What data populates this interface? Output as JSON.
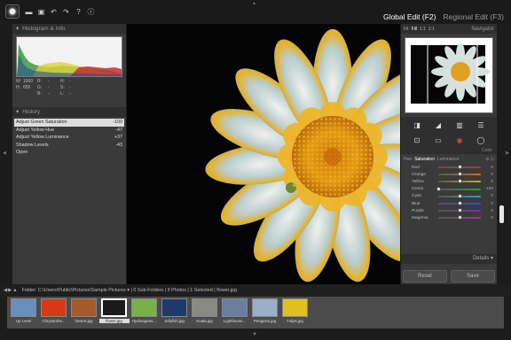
{
  "header": {
    "modes": [
      {
        "label": "Global Edit (F2)",
        "active": true
      },
      {
        "label": "Regional Edit (F3)",
        "active": false
      }
    ],
    "toolbar_icons": [
      "folder-icon",
      "save-icon",
      "undo-icon",
      "redo-icon",
      "help-icon",
      "info-icon"
    ],
    "toolbar_glyphs": [
      "▬",
      "▣",
      "↶",
      "↷",
      "?",
      "ⓘ"
    ]
  },
  "histogram": {
    "title": "Histogram & Info",
    "info_rows": [
      [
        "W:",
        "1000",
        "R:",
        "-",
        "H:",
        "-"
      ],
      [
        "H:",
        "650",
        "G:",
        "-",
        "S:",
        "-"
      ],
      [
        "",
        "",
        "B:",
        "-",
        "L:",
        "-"
      ]
    ]
  },
  "history": {
    "title": "History",
    "items": [
      {
        "label": "Adjust Green Saturation",
        "value": "-100",
        "selected": true
      },
      {
        "label": "Adjust Yellow Hue",
        "value": "-47",
        "selected": false
      },
      {
        "label": "Adjust Yellow Luminance",
        "value": "+37",
        "selected": false
      },
      {
        "label": "Shadow Levels",
        "value": "-43",
        "selected": false
      },
      {
        "label": "Open",
        "value": "",
        "selected": false
      }
    ]
  },
  "navigator": {
    "title": "Navigator",
    "zoom_options": [
      {
        "label": "Fit",
        "active": false
      },
      {
        "label": "Fill",
        "active": true
      },
      {
        "label": "1:1",
        "active": false
      },
      {
        "label": "2:1",
        "active": false
      }
    ]
  },
  "tools": {
    "icons": [
      "levels-icon",
      "tone-curve-icon",
      "channels-icon",
      "layers-icon",
      "crop-icon",
      "straighten-icon",
      "red-eye-icon",
      "vignette-icon",
      "stamp-icon"
    ],
    "glyphs": [
      "◨",
      "◢",
      "▥",
      "☰",
      "⊡",
      "▭",
      "◉",
      "◯",
      "⊥"
    ]
  },
  "color": {
    "section": "Color",
    "tabs": [
      {
        "label": "Hue",
        "active": false
      },
      {
        "label": "Saturation",
        "active": true
      },
      {
        "label": "Luminance",
        "active": false
      }
    ],
    "tab_tools": "⊕ ⊡",
    "sliders": [
      {
        "label": "Red",
        "value": "0",
        "fraction": 0.5,
        "color": "#c03030"
      },
      {
        "label": "Orange",
        "value": "0",
        "fraction": 0.5,
        "color": "#c8701c"
      },
      {
        "label": "Yellow",
        "value": "0",
        "fraction": 0.5,
        "color": "#c8b020"
      },
      {
        "label": "Green",
        "value": "-100",
        "fraction": 0.0,
        "color": "#30a030"
      },
      {
        "label": "Cyan",
        "value": "0",
        "fraction": 0.5,
        "color": "#30a0b0"
      },
      {
        "label": "Blue",
        "value": "0",
        "fraction": 0.5,
        "color": "#3050c0"
      },
      {
        "label": "Purple",
        "value": "0",
        "fraction": 0.5,
        "color": "#7a30b0"
      },
      {
        "label": "Magenta",
        "value": "0",
        "fraction": 0.5,
        "color": "#b03090"
      }
    ]
  },
  "details": {
    "label": "Details"
  },
  "buttons": {
    "reset": "Reset",
    "save": "Save"
  },
  "folder_bar": {
    "text": "Folder:  C:\\Users\\Public\\Pictures\\Sample Pictures ▾ | 0 Sub-Folders | 9 Photos | 1 Selected | flower.jpg"
  },
  "filmstrip": [
    {
      "label": "Up Level",
      "color": "#6a8fb8",
      "selected": false
    },
    {
      "label": "Chrysanthe...",
      "color": "#d63a16",
      "selected": false
    },
    {
      "label": "Desert.jpg",
      "color": "#a45a2a",
      "selected": false
    },
    {
      "label": "flower.jpg",
      "color": "#1a1a1a",
      "selected": true
    },
    {
      "label": "Hydrangeas...",
      "color": "#7ab04a",
      "selected": false
    },
    {
      "label": "Jellyfish.jpg",
      "color": "#1e3a6a",
      "selected": false
    },
    {
      "label": "Koala.jpg",
      "color": "#8a8a84",
      "selected": false
    },
    {
      "label": "Lighthouse...",
      "color": "#6a7ea0",
      "selected": false
    },
    {
      "label": "Penguins.jpg",
      "color": "#9ab0c8",
      "selected": false
    },
    {
      "label": "Tulips.jpg",
      "color": "#e2c020",
      "selected": false
    }
  ]
}
